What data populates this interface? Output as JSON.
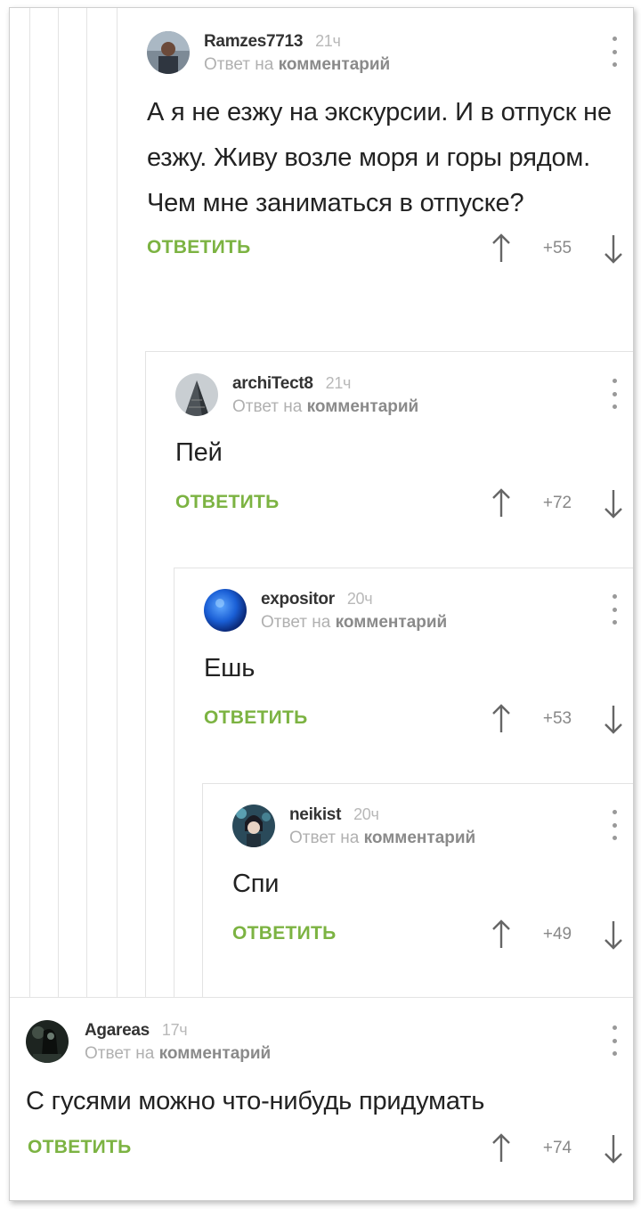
{
  "colors": {
    "accent": "#7cb342",
    "muted": "#b0b0b0",
    "text": "#222222"
  },
  "comments": [
    {
      "author": "Ramzes7713",
      "time": "21ч",
      "reply_prefix": "Ответ на",
      "reply_target": "комментарий",
      "text": "А я не езжу на экскурсии. И в отпуск не езжу. Живу возле моря и горы рядом. Чем мне заниматься в отпуске?",
      "reply_label": "ОТВЕТИТЬ",
      "score": "+55",
      "avatar_icon": "user-photo-avatar"
    },
    {
      "author": "archiTect8",
      "time": "21ч",
      "reply_prefix": "Ответ на",
      "reply_target": "комментарий",
      "text": "Пей",
      "reply_label": "ОТВЕТИТЬ",
      "score": "+72",
      "avatar_icon": "skyscraper-avatar"
    },
    {
      "author": "expositor",
      "time": "20ч",
      "reply_prefix": "Ответ на",
      "reply_target": "комментарий",
      "text": "Ешь",
      "reply_label": "ОТВЕТИТЬ",
      "score": "+53",
      "avatar_icon": "blue-planet-avatar"
    },
    {
      "author": "neikist",
      "time": "20ч",
      "reply_prefix": "Ответ на",
      "reply_target": "комментарий",
      "text": "Спи",
      "reply_label": "ОТВЕТИТЬ",
      "score": "+49",
      "avatar_icon": "anime-character-avatar"
    },
    {
      "author": "Agareas",
      "time": "17ч",
      "reply_prefix": "Ответ на",
      "reply_target": "комментарий",
      "text": "С гусями можно что-нибудь придумать",
      "reply_label": "ОТВЕТИТЬ",
      "score": "+74",
      "avatar_icon": "dark-figure-avatar"
    }
  ]
}
